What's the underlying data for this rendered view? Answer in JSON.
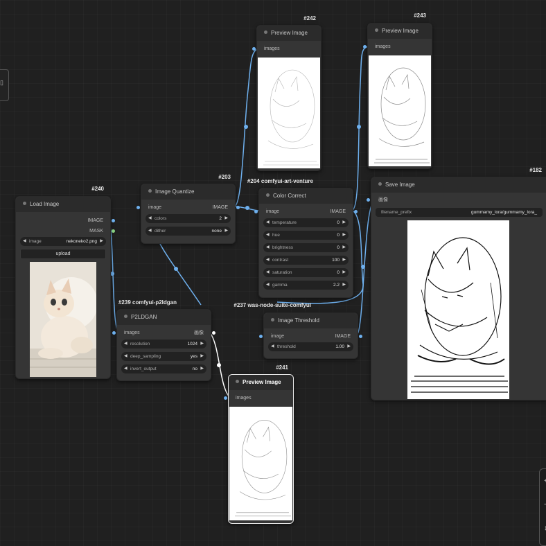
{
  "nodes": {
    "load_image": {
      "id": "#240",
      "title": "Load Image",
      "outputs": [
        "IMAGE",
        "MASK"
      ],
      "image_widget": {
        "label": "image",
        "value": "nekoneko2.png"
      },
      "upload_label": "upload"
    },
    "image_quantize": {
      "id": "#203",
      "title": "Image Quantize",
      "input": "image",
      "output": "IMAGE",
      "widgets": [
        {
          "label": "colors",
          "value": "2"
        },
        {
          "label": "dither",
          "value": "none"
        }
      ]
    },
    "p2ldgan": {
      "id": "#239 comfyui-p2ldgan",
      "title": "P2LDGAN",
      "input": "images",
      "output": "画像",
      "widgets": [
        {
          "label": "resolution",
          "value": "1024"
        },
        {
          "label": "deep_sampling",
          "value": "yes"
        },
        {
          "label": "invert_output",
          "value": "no"
        }
      ]
    },
    "color_correct": {
      "id": "#204 comfyui-art-venture",
      "title": "Color Correct",
      "input": "image",
      "output": "IMAGE",
      "widgets": [
        {
          "label": "temperature",
          "value": "0"
        },
        {
          "label": "hue",
          "value": "0"
        },
        {
          "label": "brightness",
          "value": "0"
        },
        {
          "label": "contrast",
          "value": "100"
        },
        {
          "label": "saturation",
          "value": "0"
        },
        {
          "label": "gamma",
          "value": "2.2"
        }
      ]
    },
    "image_threshold": {
      "id": "#237 was-node-suite-comfyui",
      "title": "Image Threshold",
      "input": "image",
      "output": "IMAGE",
      "widgets": [
        {
          "label": "threshold",
          "value": "1.00"
        }
      ]
    },
    "preview_242": {
      "id": "#242",
      "title": "Preview Image",
      "input": "images"
    },
    "preview_243": {
      "id": "#243",
      "title": "Preview Image",
      "input": "images"
    },
    "preview_241": {
      "id": "#241",
      "title": "Preview Image",
      "input": "images"
    },
    "save_image": {
      "id": "#182",
      "title": "Save Image",
      "input": "画像",
      "widget": {
        "label": "filename_prefix",
        "value": "gummamy_lora/gummamy_lora_"
      }
    }
  },
  "colors": {
    "background": "#202020",
    "node_body": "#353535",
    "node_title": "#2b2b2b",
    "image_link": "#6eb0ee",
    "mask_slot": "#88d080"
  },
  "icons": {
    "side_tab": "panel-toggle-icon",
    "corner_controls": "zoom-controls-icon"
  }
}
